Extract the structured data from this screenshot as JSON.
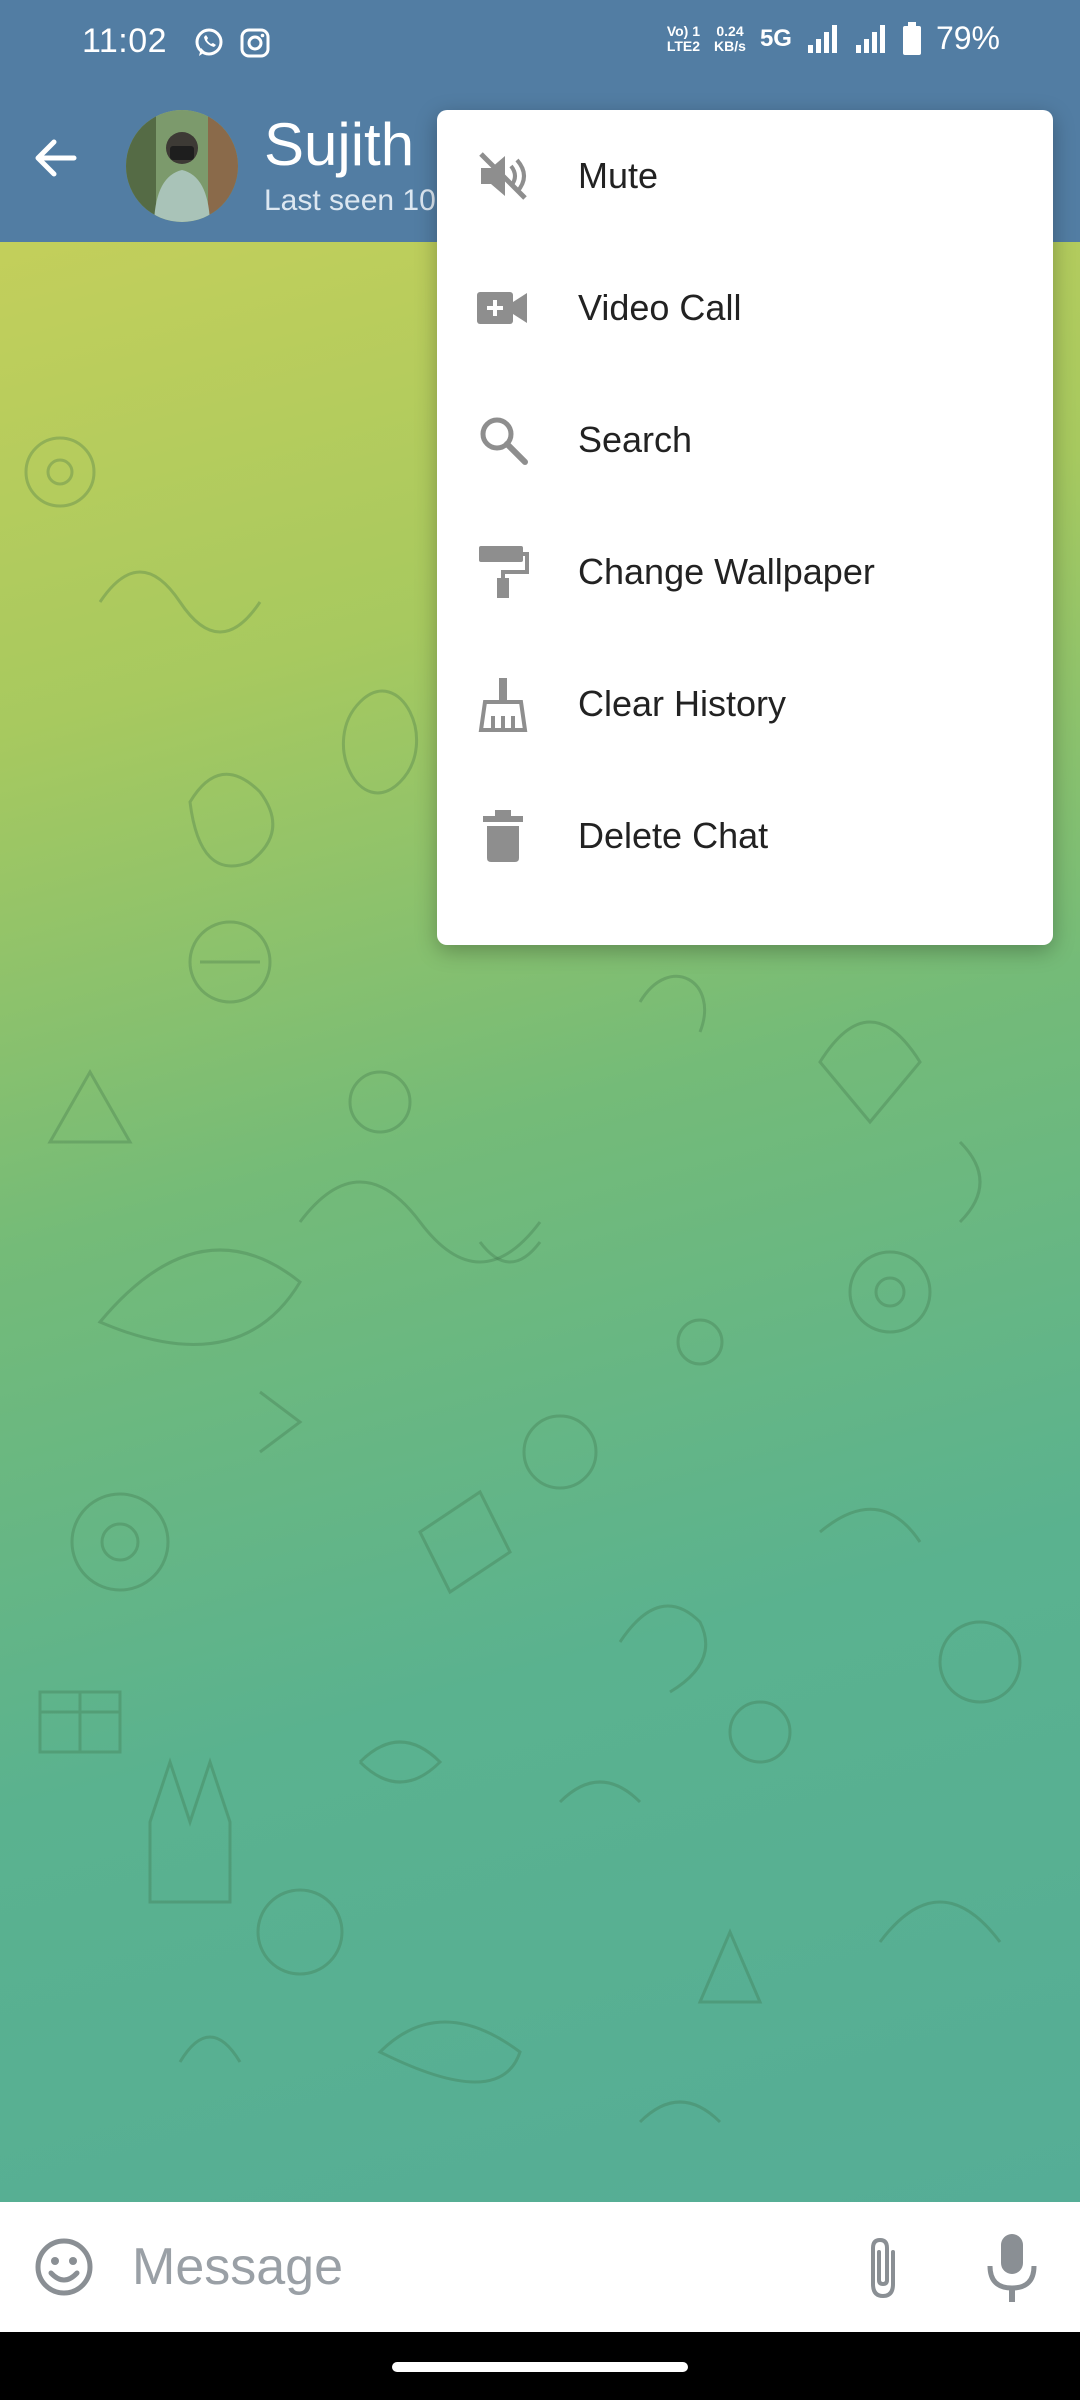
{
  "status_bar": {
    "time": "11:02",
    "net_top": "Vo) 1",
    "net_bottom": "LTE2",
    "speed_value": "0.24",
    "speed_unit": "KB/s",
    "network": "5G",
    "battery": "79%",
    "app_icons": [
      "whatsapp-icon",
      "instagram-icon"
    ]
  },
  "header": {
    "name": "Sujith",
    "status": "Last seen 10"
  },
  "menu": {
    "items": [
      {
        "label": "Mute",
        "icon": "mute-icon"
      },
      {
        "label": "Video Call",
        "icon": "video-call-icon"
      },
      {
        "label": "Search",
        "icon": "search-icon"
      },
      {
        "label": "Change Wallpaper",
        "icon": "paint-roller-icon"
      },
      {
        "label": "Clear History",
        "icon": "broom-icon"
      },
      {
        "label": "Delete Chat",
        "icon": "trash-icon"
      }
    ]
  },
  "input": {
    "placeholder": "Message"
  },
  "colors": {
    "header": "#527da3",
    "menu_icon": "#8e8e8e",
    "wallpaper_top": "#c3cf5b",
    "wallpaper_bottom": "#55ad96"
  }
}
